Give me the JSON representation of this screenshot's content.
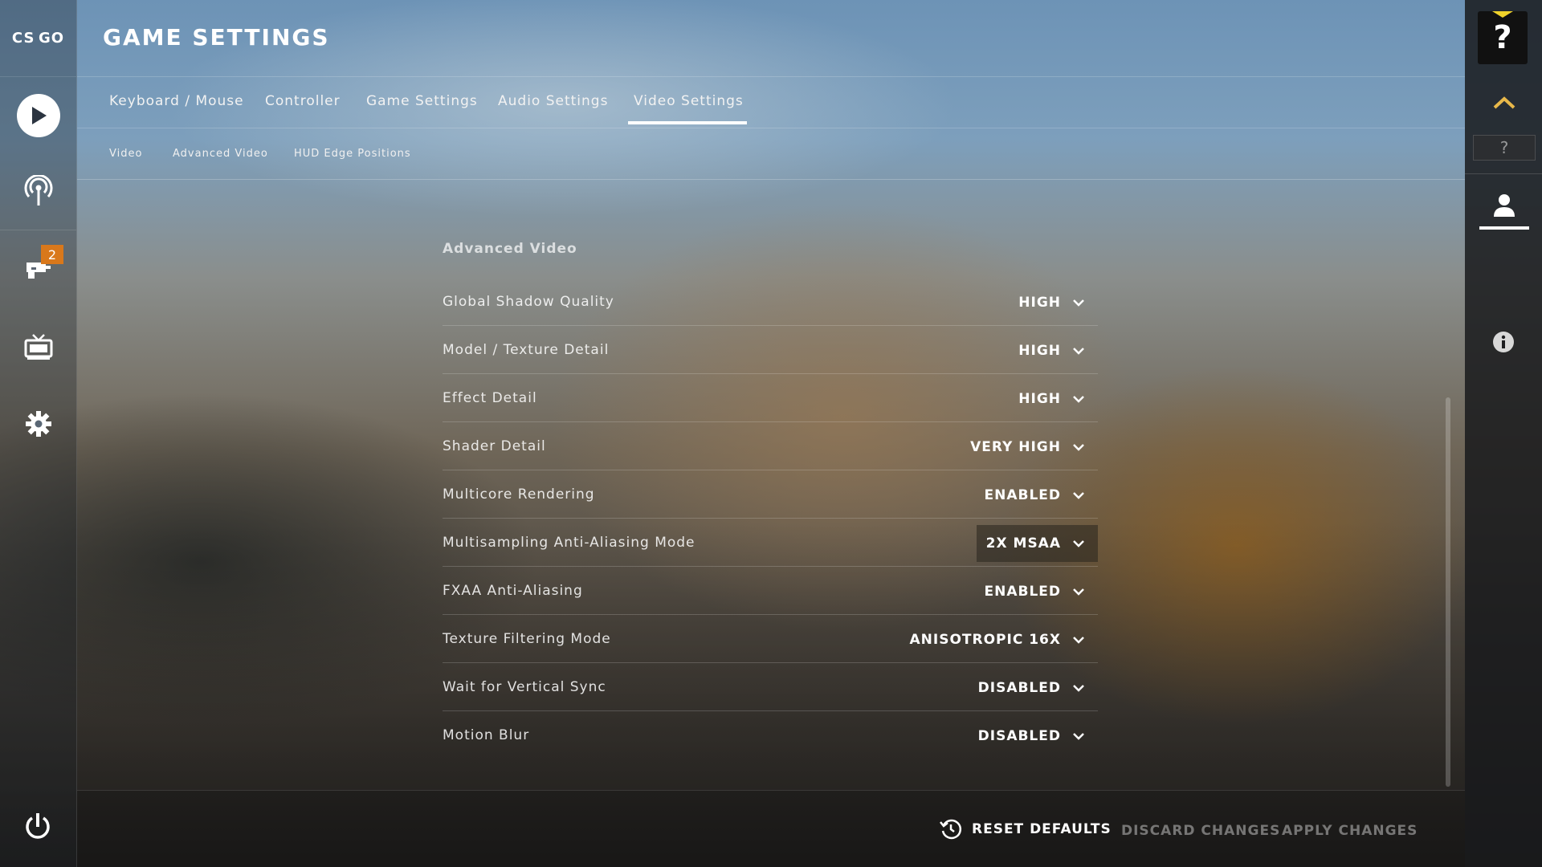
{
  "app": {
    "logo_text": "CS GO",
    "title": "GAME SETTINGS"
  },
  "sidebar": {
    "items": [
      {
        "name": "play",
        "icon": "play-icon"
      },
      {
        "name": "broadcast",
        "icon": "broadcast-icon"
      },
      {
        "name": "inventory",
        "icon": "inventory-icon",
        "badge": "2"
      },
      {
        "name": "watch",
        "icon": "tv-icon"
      },
      {
        "name": "settings",
        "icon": "gear-icon"
      }
    ],
    "power_icon": "power-icon"
  },
  "tabs": [
    {
      "label": "Keyboard / Mouse",
      "active": false
    },
    {
      "label": "Controller",
      "active": false
    },
    {
      "label": "Game Settings",
      "active": false
    },
    {
      "label": "Audio Settings",
      "active": false
    },
    {
      "label": "Video Settings",
      "active": true
    }
  ],
  "subtabs": [
    {
      "label": "Video"
    },
    {
      "label": "Advanced Video"
    },
    {
      "label": "HUD Edge Positions"
    }
  ],
  "panel": {
    "section_title": "Advanced Video",
    "rows": [
      {
        "label": "Global Shadow Quality",
        "value": "HIGH"
      },
      {
        "label": "Model / Texture Detail",
        "value": "HIGH"
      },
      {
        "label": "Effect Detail",
        "value": "HIGH"
      },
      {
        "label": "Shader Detail",
        "value": "VERY HIGH"
      },
      {
        "label": "Multicore Rendering",
        "value": "ENABLED"
      },
      {
        "label": "Multisampling Anti-Aliasing Mode",
        "value": "2X MSAA"
      },
      {
        "label": "FXAA Anti-Aliasing",
        "value": "ENABLED"
      },
      {
        "label": "Texture Filtering Mode",
        "value": "ANISOTROPIC 16X"
      },
      {
        "label": "Wait for Vertical Sync",
        "value": "DISABLED"
      },
      {
        "label": "Motion Blur",
        "value": "DISABLED"
      }
    ]
  },
  "footer": {
    "reset_label": "RESET DEFAULTS",
    "discard_label": "DISCARD CHANGES",
    "apply_label": "APPLY CHANGES"
  },
  "right_panel": {
    "help_label": "?",
    "small_help_label": "?"
  },
  "colors": {
    "badge": "#d9781b",
    "help_accent": "#f0d22a",
    "chevron_up": "#e8b84a"
  }
}
